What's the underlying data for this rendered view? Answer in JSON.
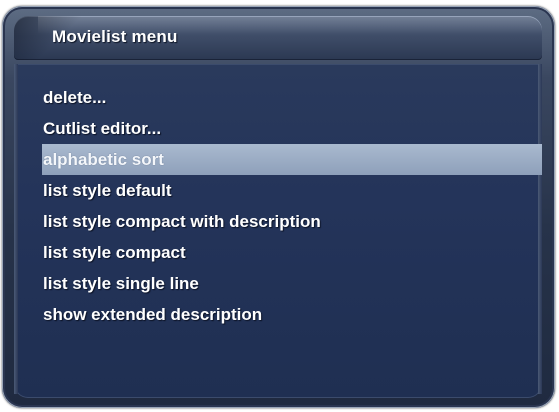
{
  "window": {
    "title": "Movielist menu"
  },
  "menu": {
    "items": [
      {
        "label": "delete...",
        "selected": false
      },
      {
        "label": "Cutlist editor...",
        "selected": false
      },
      {
        "label": "alphabetic sort",
        "selected": true
      },
      {
        "label": "list style default",
        "selected": false
      },
      {
        "label": "list style compact with description",
        "selected": false
      },
      {
        "label": "list style compact",
        "selected": false
      },
      {
        "label": "list style single line",
        "selected": false
      },
      {
        "label": "show extended description",
        "selected": false
      }
    ]
  },
  "colors": {
    "frame": "#3a4760",
    "panel": "#24345a",
    "selection": "#9aabc4",
    "text": "#ffffff"
  }
}
